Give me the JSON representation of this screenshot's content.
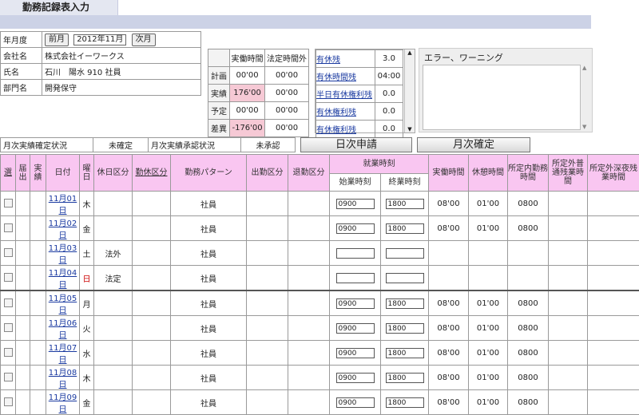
{
  "title": "勤務記録表入力",
  "info": {
    "year_month_label": "年月度",
    "prev_label": "前月",
    "month_value": "2012年11月",
    "next_label": "次月",
    "company_label": "会社名",
    "company_value": "株式会社イーワークス",
    "name_label": "氏名",
    "name_value": "石川　陽水 910 社員",
    "dept_label": "部門名",
    "dept_value": "開発保守"
  },
  "summary": {
    "headers": [
      "実働時間",
      "法定時間外"
    ],
    "rows": [
      {
        "label": "計画",
        "work": "00'00",
        "over": "00'00"
      },
      {
        "label": "実績",
        "work": "176'00",
        "over": "00'00"
      },
      {
        "label": "予定",
        "work": "00'00",
        "over": "00'00"
      },
      {
        "label": "差異",
        "work": "-176'00",
        "over": "00'00"
      }
    ]
  },
  "leave": [
    {
      "label": "有休残",
      "value": "3.0"
    },
    {
      "label": "有休時間残",
      "value": "04:00"
    },
    {
      "label": "半日有休権利残",
      "value": "0.0"
    },
    {
      "label": "有休権利残",
      "value": "0.0"
    },
    {
      "label": "有休権利残",
      "value": "0.0"
    }
  ],
  "errors_label": "エラー、ワーニング",
  "status": {
    "monthly_actual_label": "月次実績確定状況",
    "monthly_actual_value": "未確定",
    "monthly_approval_label": "月次実績承認状況",
    "monthly_approval_value": "未承認",
    "daily_request_button": "日次申請",
    "monthly_confirm_button": "月次確定"
  },
  "table": {
    "headers": {
      "select": "選",
      "submit": "届出",
      "actual": "実績",
      "date": "日付",
      "weekday": "曜日",
      "holiday_type": "休日区分",
      "leave_type": "勤休区分",
      "pattern": "勤務パターン",
      "arrival": "出勤区分",
      "leave": "退勤区分",
      "work_time": "就業時刻",
      "start": "始業時刻",
      "end": "終業時刻",
      "actual_hours": "実働時間",
      "break": "休憩時間",
      "regular": "所定内勤務時間",
      "overtime": "所定外普通残業時間",
      "night": "所定外深夜残業時間"
    },
    "rows": [
      {
        "date": "11月01日",
        "wd": "木",
        "hol": "",
        "pattern": "社員",
        "start": "0900",
        "end": "1800",
        "work": "08'00",
        "brk": "01'00",
        "reg": "0800"
      },
      {
        "date": "11月02日",
        "wd": "金",
        "hol": "",
        "pattern": "社員",
        "start": "0900",
        "end": "1800",
        "work": "08'00",
        "brk": "01'00",
        "reg": "0800"
      },
      {
        "date": "11月03日",
        "wd": "土",
        "hol": "法外",
        "pattern": "社員",
        "start": "",
        "end": "",
        "work": "",
        "brk": "",
        "reg": ""
      },
      {
        "date": "11月04日",
        "wd": "日",
        "hol": "法定",
        "pattern": "社員",
        "start": "",
        "end": "",
        "work": "",
        "brk": "",
        "reg": ""
      },
      {
        "date": "11月05日",
        "wd": "月",
        "hol": "",
        "pattern": "社員",
        "start": "0900",
        "end": "1800",
        "work": "08'00",
        "brk": "01'00",
        "reg": "0800"
      },
      {
        "date": "11月06日",
        "wd": "火",
        "hol": "",
        "pattern": "社員",
        "start": "0900",
        "end": "1800",
        "work": "08'00",
        "brk": "01'00",
        "reg": "0800"
      },
      {
        "date": "11月07日",
        "wd": "水",
        "hol": "",
        "pattern": "社員",
        "start": "0900",
        "end": "1800",
        "work": "08'00",
        "brk": "01'00",
        "reg": "0800"
      },
      {
        "date": "11月08日",
        "wd": "木",
        "hol": "",
        "pattern": "社員",
        "start": "0900",
        "end": "1800",
        "work": "08'00",
        "brk": "01'00",
        "reg": "0800"
      },
      {
        "date": "11月09日",
        "wd": "金",
        "hol": "",
        "pattern": "社員",
        "start": "0900",
        "end": "1800",
        "work": "08'00",
        "brk": "01'00",
        "reg": "0800"
      }
    ]
  }
}
